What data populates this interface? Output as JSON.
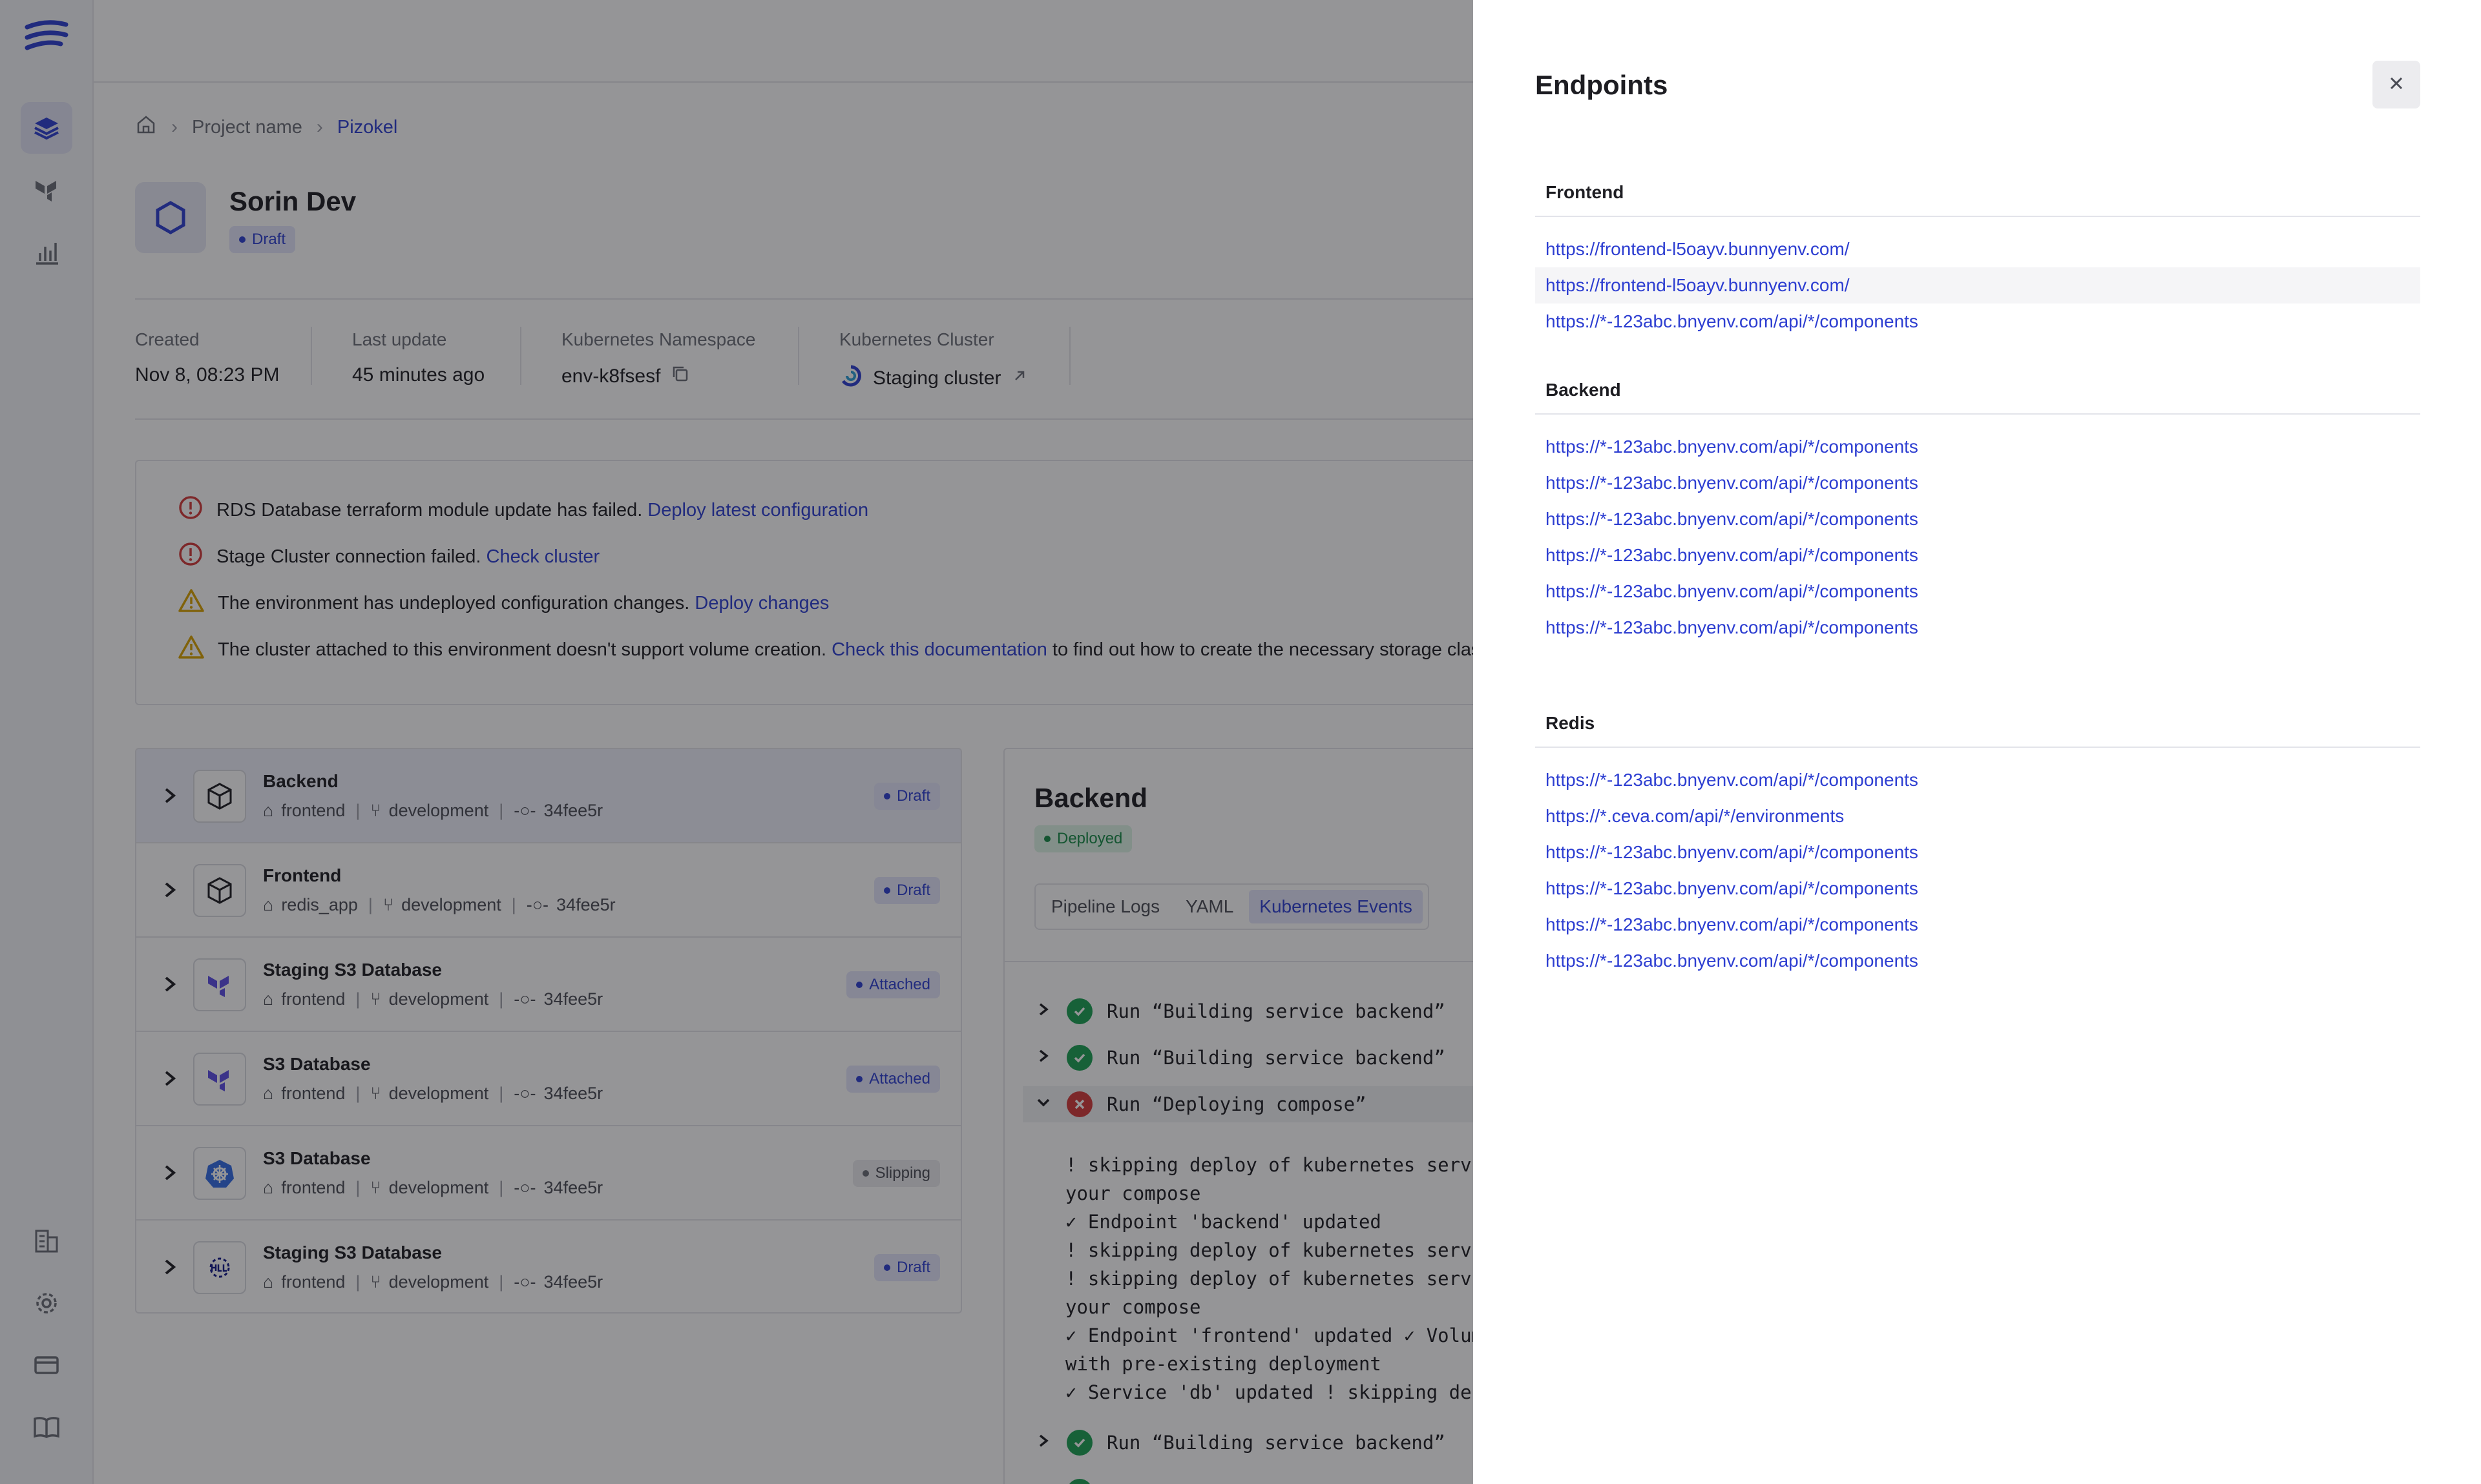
{
  "breadcrumb": {
    "project": "Project name",
    "current": "Pizokel"
  },
  "env": {
    "name": "Sorin Dev",
    "status": "Draft"
  },
  "meta": [
    {
      "label": "Created",
      "value": "Nov 8, 08:23 PM"
    },
    {
      "label": "Last update",
      "value": "45 minutes ago"
    },
    {
      "label": "Kubernetes Namespace",
      "value": "env-k8fsesf"
    },
    {
      "label": "Kubernetes Cluster",
      "value": "Staging cluster"
    }
  ],
  "alerts": [
    {
      "type": "error",
      "text": "RDS Database terraform module update has failed.",
      "link": "Deploy latest configuration",
      "after": ""
    },
    {
      "type": "error",
      "text": "Stage Cluster connection failed.",
      "link": "Check cluster",
      "after": ""
    },
    {
      "type": "warning",
      "text": "The environment has undeployed configuration changes.",
      "link": "Deploy changes",
      "after": ""
    },
    {
      "type": "warning",
      "text": "The cluster attached to this environment doesn't support volume creation.",
      "link": "Check this documentation",
      "after": "to find out how to create the necessary storage classe"
    }
  ],
  "services": [
    {
      "name": "Backend",
      "repo": "frontend",
      "branch": "development",
      "commit": "34fee5r",
      "status": "Draft",
      "icon": "cube-icon"
    },
    {
      "name": "Frontend",
      "repo": "redis_app",
      "branch": "development",
      "commit": "34fee5r",
      "status": "Draft",
      "icon": "cube-icon"
    },
    {
      "name": "Staging S3 Database",
      "repo": "frontend",
      "branch": "development",
      "commit": "34fee5r",
      "status": "Attached",
      "icon": "terraform-icon"
    },
    {
      "name": "S3 Database",
      "repo": "frontend",
      "branch": "development",
      "commit": "34fee5r",
      "status": "Attached",
      "icon": "terraform-icon"
    },
    {
      "name": "S3 Database",
      "repo": "frontend",
      "branch": "development",
      "commit": "34fee5r",
      "status": "Slipping",
      "icon": "kubernetes-icon"
    },
    {
      "name": "Staging S3 Database",
      "repo": "frontend",
      "branch": "development",
      "commit": "34fee5r",
      "status": "Draft",
      "icon": "helm-icon"
    }
  ],
  "panel": {
    "title": "Backend",
    "status": "Deployed",
    "tabs": [
      "Pipeline Logs",
      "YAML",
      "Kubernetes Events"
    ],
    "runs": [
      "Run “Building service backend”",
      "Run “Building service backend”",
      "Run “Deploying compose”",
      "Run “Building service backend”"
    ],
    "log": "! skipping deploy of kubernetes servic\nyour compose\n✓ Endpoint 'backend' updated\n! skipping deploy of kubernetes servic\n! skipping deploy of kubernetes servic\nyour compose\n✓ Endpoint 'frontend' updated ✓ Volume\nwith pre-existing deployment\n✓ Service 'db' updated ! skipping depl"
  },
  "drawer": {
    "title": "Endpoints",
    "frontend": {
      "heading": "Frontend",
      "links": [
        "https://frontend-l5oayv.bunnyenv.com/",
        "https://frontend-l5oayv.bunnyenv.com/",
        "https://*-123abc.bnyenv.com/api/*/components"
      ]
    },
    "backend": {
      "heading": "Backend",
      "links": [
        "https://*-123abc.bnyenv.com/api/*/components",
        "https://*-123abc.bnyenv.com/api/*/components",
        "https://*-123abc.bnyenv.com/api/*/components",
        "https://*-123abc.bnyenv.com/api/*/components",
        "https://*-123abc.bnyenv.com/api/*/components",
        "https://*-123abc.bnyenv.com/api/*/components"
      ]
    },
    "redis": {
      "heading": "Redis",
      "links": [
        "https://*-123abc.bnyenv.com/api/*/components",
        "https://*.ceva.com/api/*/environments",
        "https://*-123abc.bnyenv.com/api/*/components",
        "https://*-123abc.bnyenv.com/api/*/components",
        "https://*-123abc.bnyenv.com/api/*/components",
        "https://*-123abc.bnyenv.com/api/*/components"
      ]
    }
  },
  "colors": {
    "accent": "#2d3ed1",
    "success": "#1aa053",
    "error": "#d43a3a",
    "warning": "#d9a300"
  }
}
